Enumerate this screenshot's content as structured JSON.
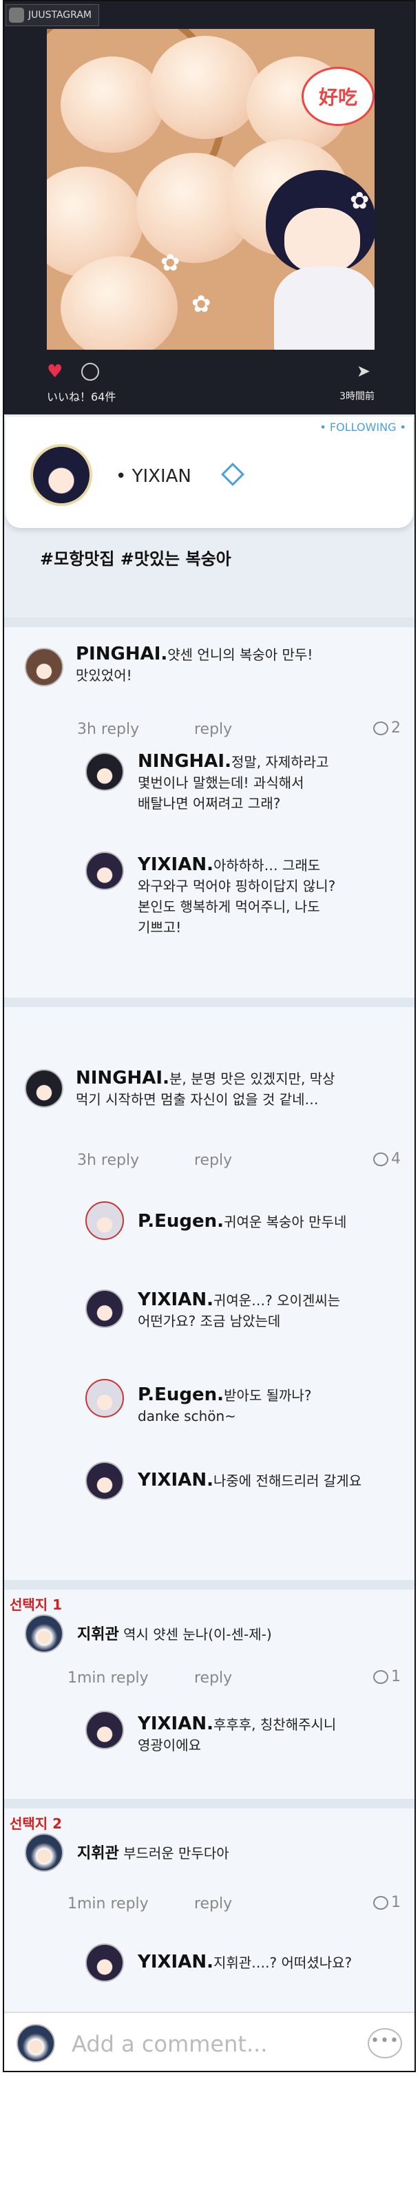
{
  "app": {
    "name": "JUUSTAGRAM"
  },
  "photo": {
    "bubble_text": "好吃",
    "likes": "いいね！64件",
    "time_ago": "3時間前"
  },
  "profile": {
    "following": "• FOLLOWING •",
    "name": "• YIXIAN"
  },
  "post": {
    "hashtags": "#모항맛집 #맛있는 복숭아"
  },
  "comments": [
    {
      "author": "PINGHAI.",
      "text_l1": "얏센 언니의 복숭아 만두!",
      "text_l2": "맛있었어!",
      "time": "3h reply",
      "reply": "reply",
      "count": "2",
      "replies": [
        {
          "author": "NINGHAI.",
          "l1": "정말, 자제하라고",
          "l2": "몇번이나 말했는데! 과식해서",
          "l3": "배탈나면 어쩌려고 그래?"
        },
        {
          "author": "YIXIAN.",
          "l1": "아하하하… 그래도",
          "l2": "와구와구 먹어야 핑하이답지 않니?",
          "l3": "본인도 행복하게 먹어주니, 나도",
          "l4": "기쁘고!"
        }
      ]
    },
    {
      "author": "NINGHAI.",
      "text_l1": "분, 분명 맛은 있겠지만, 막상",
      "text_l2": "먹기 시작하면 멈출 자신이 없을 것 같네…",
      "time": "3h reply",
      "reply": "reply",
      "count": "4",
      "replies": [
        {
          "author": "P.Eugen.",
          "l1": "귀여운 복숭아 만두네"
        },
        {
          "author": "YIXIAN.",
          "l1": "귀여운…? 오이겐씨는",
          "l2": "어떤가요? 조금 남았는데"
        },
        {
          "author": "P.Eugen.",
          "l1": "받아도 될까나?",
          "l2": "danke schön~"
        },
        {
          "author": "YIXIAN.",
          "l1": "나중에 전해드리러 갈게요"
        }
      ]
    }
  ],
  "choices": [
    {
      "label": "선택지 1",
      "author": "지휘관",
      "text": "역시 얏센 눈나(이-센-제-)",
      "time": "1min reply",
      "reply": "reply",
      "count": "1",
      "reply_author": "YIXIAN.",
      "reply_l1": "후후후, 칭찬해주시니",
      "reply_l2": "영광이에요"
    },
    {
      "label": "선택지 2",
      "author": "지휘관",
      "text": "부드러운 만두다아",
      "time": "1min reply",
      "reply": "reply",
      "count": "1",
      "reply_author": "YIXIAN.",
      "reply_l1": "지휘관….? 어떠셨나요?"
    }
  ],
  "input": {
    "placeholder": "Add a comment..."
  }
}
